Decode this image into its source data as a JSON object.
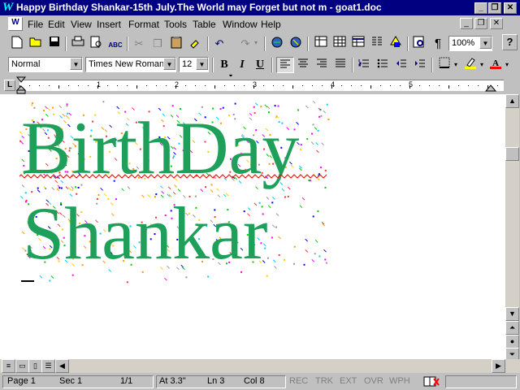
{
  "window": {
    "title": "Happy Birthday Shankar-15th July.The World may Forget but not m - goat1.doc",
    "buttons": [
      "_",
      "❐",
      "✕"
    ],
    "doc_buttons": [
      "_",
      "❐",
      "✕"
    ]
  },
  "menu": {
    "items": [
      "File",
      "Edit",
      "View",
      "Insert",
      "Format",
      "Tools",
      "Table",
      "Window",
      "Help"
    ],
    "help_btn": "?"
  },
  "standard_toolbar": {
    "zoom": "100%"
  },
  "format_toolbar": {
    "style": "Normal",
    "font": "Times New Roman",
    "size": "12",
    "bold": "B",
    "italic": "I",
    "underline": "U"
  },
  "ruler": {
    "numbers": [
      "1",
      "2",
      "3",
      "4",
      "5"
    ]
  },
  "document": {
    "line1": "BirthDay",
    "line2": "Shankar"
  },
  "status": {
    "page": "Page 1",
    "sec": "Sec 1",
    "pages": "1/1",
    "at": "At 3.3\"",
    "ln": "Ln 3",
    "col": "Col 8",
    "rec": "REC",
    "trk": "TRK",
    "ext": "EXT",
    "ovr": "OVR",
    "wph": "WPH"
  }
}
